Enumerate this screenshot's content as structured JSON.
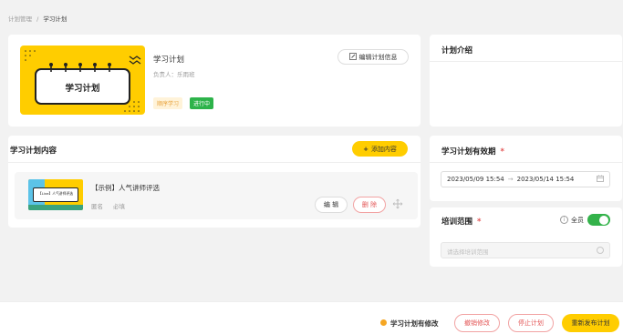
{
  "breadcrumb": {
    "parent": "计划管理",
    "sep": "/",
    "current": "学习计划"
  },
  "plan": {
    "cover_title": "学习计划",
    "title": "学习计划",
    "owner": "负责人：乐雨班",
    "edit_label": "编辑计划信息",
    "tag_order": "顺序学习",
    "tag_status": "进行中"
  },
  "intro": {
    "title": "计划介绍"
  },
  "content": {
    "title": "学习计划内容",
    "add_label": "添加内容",
    "item": {
      "title": "【示例】人气讲师评选",
      "thumb_text": "【Live】人气讲师评选",
      "anon": "匿名",
      "required": "必填",
      "edit": "编 辑",
      "delete": "删 除"
    }
  },
  "validity": {
    "title": "学习计划有效期",
    "required_mark": "*",
    "start": "2023/05/09 15:54",
    "arrow": "→",
    "end": "2023/05/14 15:54"
  },
  "scope": {
    "title": "培训范围",
    "required_mark": "*",
    "all_label": "全员",
    "placeholder": "请选择培训范围"
  },
  "footer": {
    "notice": "学习计划有修改",
    "undo": "撤销修改",
    "stop": "停止计划",
    "republish": "重新发布计划"
  },
  "colors": {
    "accent": "#ffcd00",
    "toggle": "#33b24a",
    "danger": "#e35454",
    "status": "#2db34a"
  }
}
